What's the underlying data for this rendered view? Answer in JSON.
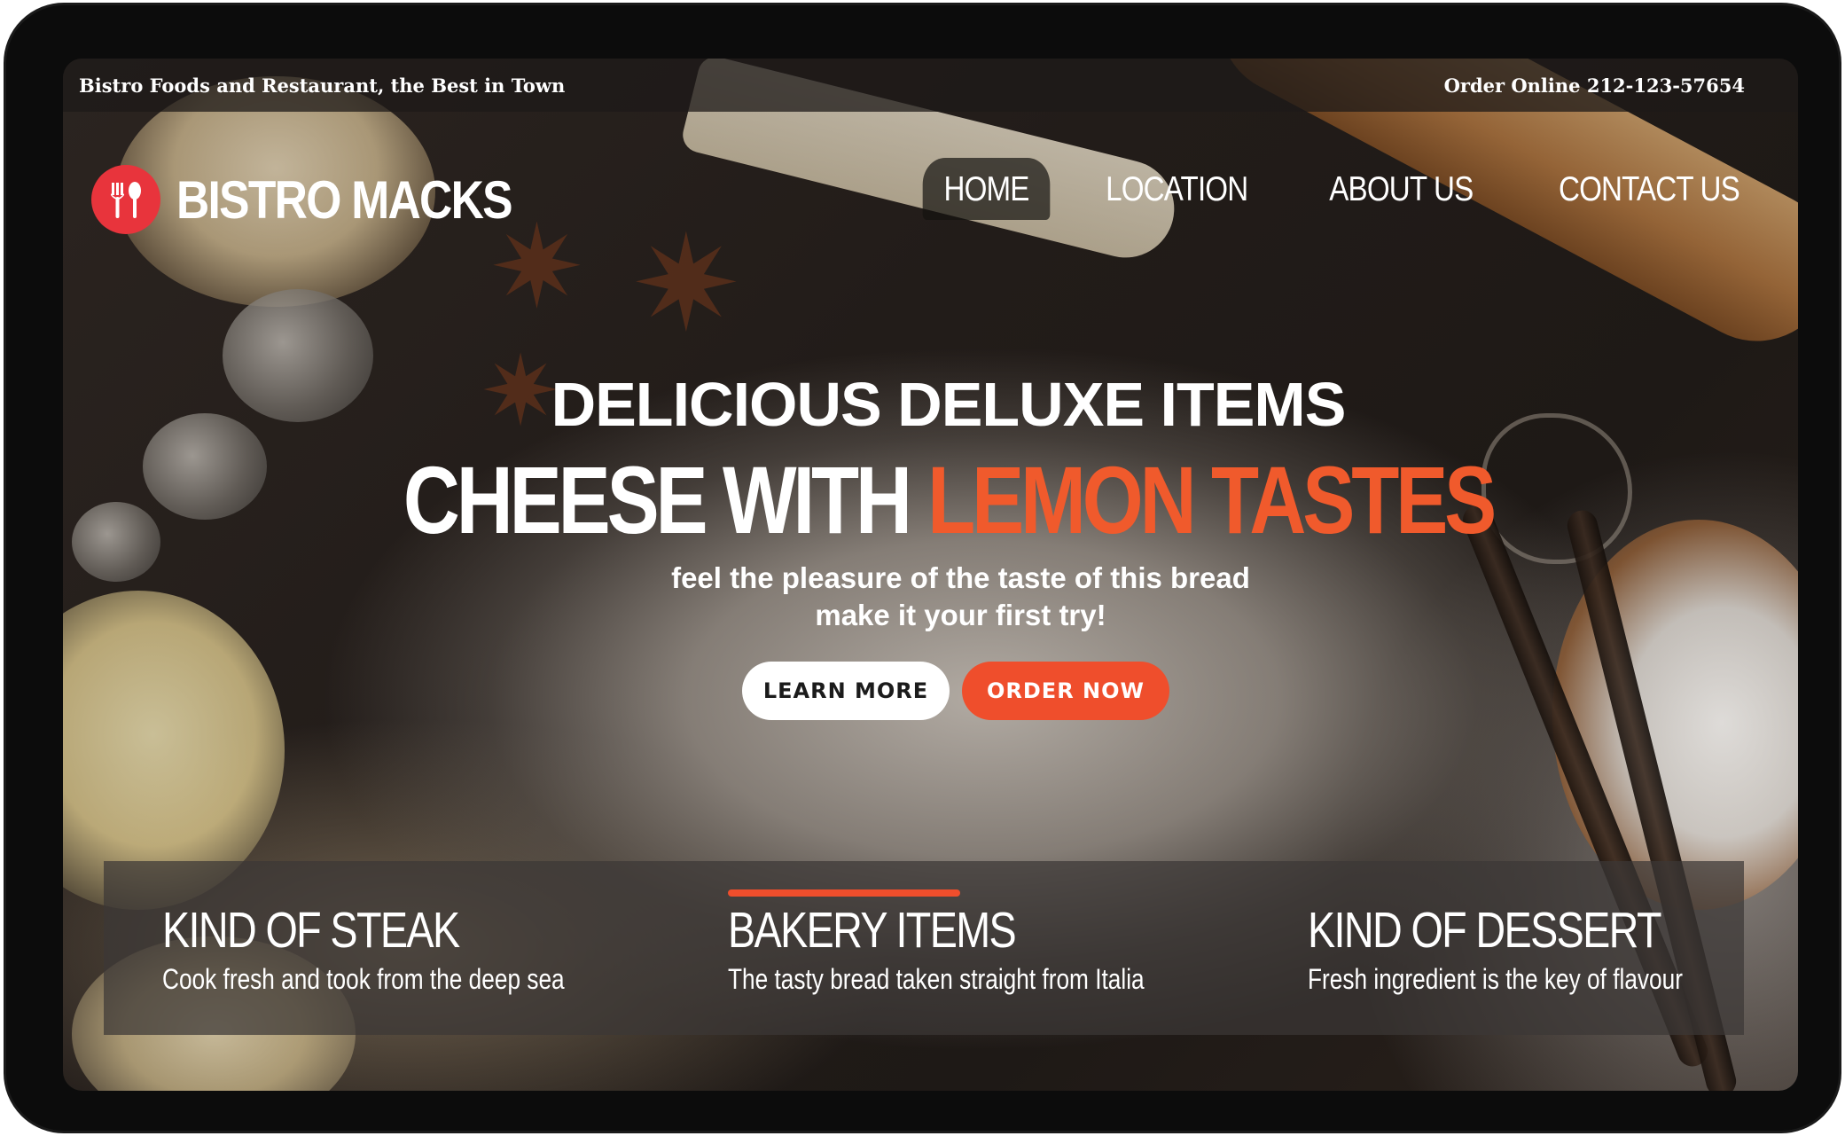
{
  "topbar": {
    "tagline": "Bistro Foods and Restaurant, the Best in Town",
    "order_online": "Order Online 212-123-57654"
  },
  "brand": {
    "name": "BISTRO MACKS",
    "logo_icon": "fork-spoon-icon",
    "logo_color": "#e8343c"
  },
  "nav": {
    "items": [
      {
        "label": "HOME",
        "active": true
      },
      {
        "label": "LOCATION",
        "active": false
      },
      {
        "label": "ABOUT US",
        "active": false
      },
      {
        "label": "CONTACT US",
        "active": false
      }
    ]
  },
  "hero": {
    "kicker": "DELICIOUS DELUXE ITEMS",
    "title_white": "CHEESE WITH",
    "title_accent": "LEMON TASTES",
    "subtitle_line1": "feel the pleasure of the taste of this bread",
    "subtitle_line2": "make it your first try!",
    "learn_more": "LEARN MORE",
    "order_now": "ORDER NOW",
    "accent_color": "#f05a2c"
  },
  "features": [
    {
      "title": "KIND OF STEAK",
      "description": "Cook fresh and took from the deep sea"
    },
    {
      "title": "BAKERY ITEMS",
      "description": "The tasty bread taken straight from Italia",
      "highlighted": true
    },
    {
      "title": "KIND OF DESSERT",
      "description": "Fresh ingredient is the key of flavour"
    }
  ]
}
